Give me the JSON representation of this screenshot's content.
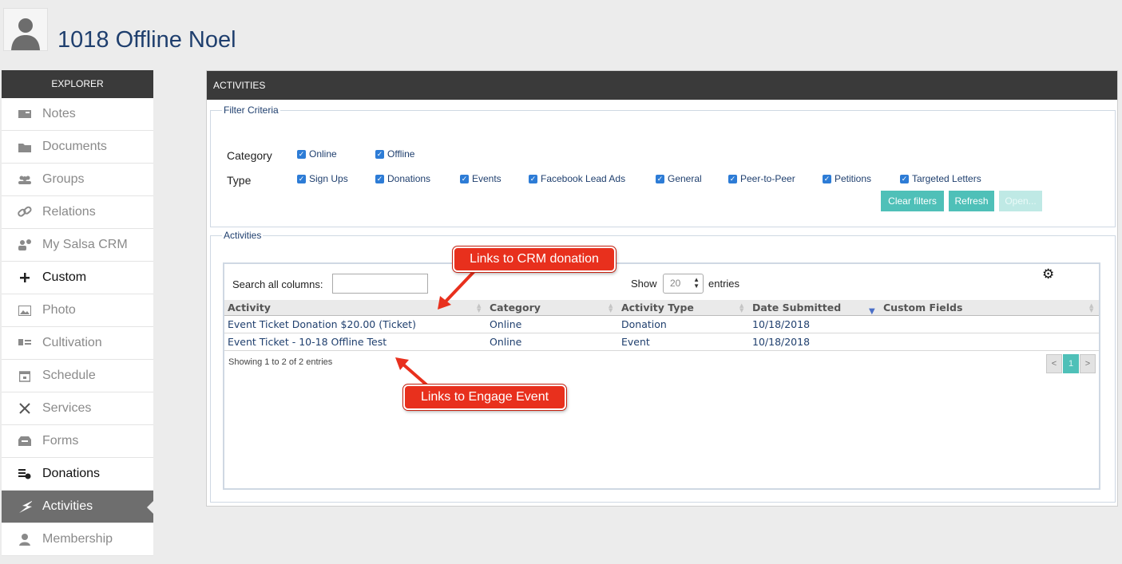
{
  "page": {
    "title": "1018 Offline Noel",
    "avatar_icon": "user-silhouette-icon"
  },
  "sidebar": {
    "header": "EXPLORER",
    "items": [
      {
        "label": "Notes",
        "icon": "notes-icon"
      },
      {
        "label": "Documents",
        "icon": "folder-icon"
      },
      {
        "label": "Groups",
        "icon": "groups-icon"
      },
      {
        "label": "Relations",
        "icon": "link-icon"
      },
      {
        "label": "My Salsa CRM",
        "icon": "crm-icon"
      },
      {
        "label": "Custom",
        "icon": "plus-icon"
      },
      {
        "label": "Photo",
        "icon": "photo-icon"
      },
      {
        "label": "Cultivation",
        "icon": "cultivation-icon"
      },
      {
        "label": "Schedule",
        "icon": "calendar-icon"
      },
      {
        "label": "Services",
        "icon": "tools-icon"
      },
      {
        "label": "Forms",
        "icon": "forms-icon"
      },
      {
        "label": "Donations",
        "icon": "coins-icon"
      },
      {
        "label": "Activities",
        "icon": "lightning-icon"
      },
      {
        "label": "Membership",
        "icon": "member-icon"
      }
    ]
  },
  "activities_panel": {
    "header": "ACTIVITIES",
    "filter": {
      "legend": "Filter Criteria",
      "category_label": "Category",
      "type_label": "Type",
      "categories": [
        "Online",
        "Offline"
      ],
      "types": [
        "Sign Ups",
        "Donations",
        "Events",
        "Facebook Lead Ads",
        "General",
        "Peer-to-Peer",
        "Petitions",
        "Targeted Letters"
      ],
      "buttons": {
        "clear": "Clear filters",
        "refresh": "Refresh",
        "open": "Open..."
      }
    },
    "activities": {
      "legend": "Activities",
      "search_label": "Search all columns:",
      "search_value": "",
      "show_label": "Show",
      "show_value": "20",
      "entries_label": "entries",
      "columns": [
        "Activity",
        "Category",
        "Activity Type",
        "Date Submitted",
        "Custom Fields"
      ],
      "rows": [
        [
          "Event Ticket Donation $20.00 (Ticket)",
          "Online",
          "Donation",
          "10/18/2018",
          ""
        ],
        [
          "Event Ticket - 10-18 Offline Test",
          "Online",
          "Event",
          "10/18/2018",
          ""
        ]
      ],
      "info": "Showing 1 to 2 of 2 entries",
      "pager": {
        "prev": "<",
        "page": "1",
        "next": ">"
      }
    }
  },
  "annotations": {
    "crm_donation": "Links to CRM donation",
    "engage_event": "Links to Engage Event"
  },
  "colors": {
    "accent": "#4fc0b8",
    "header_bar": "#3a3a3a",
    "link_text": "#1f3f6e",
    "callout": "#e8301d"
  }
}
